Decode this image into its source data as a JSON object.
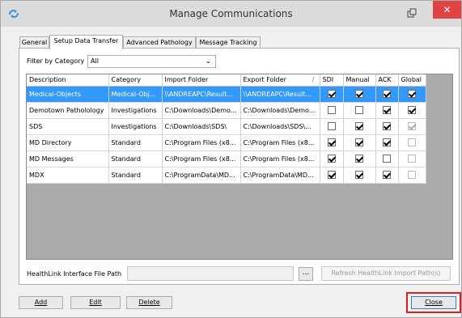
{
  "window": {
    "title": "Manage Communications",
    "close_glyph": "✕"
  },
  "tabs": [
    {
      "label": "General"
    },
    {
      "label": "Setup Data Transfer"
    },
    {
      "label": "Advanced Pathology"
    },
    {
      "label": "Message Tracking"
    }
  ],
  "filter": {
    "label": "Filter by Category",
    "value": "All"
  },
  "table": {
    "columns": [
      "Description",
      "Category",
      "Import Folder",
      "Export Folder",
      "SDI",
      "Manual",
      "ACK",
      "Global"
    ],
    "sort_glyph": "/",
    "rows": [
      {
        "description": "Medical-Objects",
        "category": "Medical-Obj...",
        "import": "\\\\ANDREAPC\\Result...",
        "export": "\\\\ANDREAPC\\Result...",
        "sdi": true,
        "manual": true,
        "ack": true,
        "global": true,
        "global_disabled": false,
        "selected": true
      },
      {
        "description": "Demotown Patholology",
        "category": "Investigations",
        "import": "C:\\Downloads\\Demo...",
        "export": "C:\\Downloads\\Demo...",
        "sdi": false,
        "manual": false,
        "ack": true,
        "global": true,
        "global_disabled": false,
        "selected": false
      },
      {
        "description": "SDS",
        "category": "Investigations",
        "import": "C:\\Downloads\\SDS\\",
        "export": "C:\\Downloads\\SDS\\...",
        "sdi": false,
        "manual": true,
        "ack": true,
        "global": true,
        "global_disabled": true,
        "selected": false
      },
      {
        "description": "MD Directory",
        "category": "Standard",
        "import": "C:\\Program Files (x8...",
        "export": "C:\\Program Files (x8...",
        "sdi": true,
        "manual": true,
        "ack": true,
        "global": false,
        "global_disabled": true,
        "selected": false
      },
      {
        "description": "MD Messages",
        "category": "Standard",
        "import": "C:\\Program Files (x8...",
        "export": "C:\\Program Files (x8...",
        "sdi": true,
        "manual": true,
        "ack": false,
        "global": false,
        "global_disabled": true,
        "selected": false
      },
      {
        "description": "MDX",
        "category": "Standard",
        "import": "C:\\ProgramData\\MD...",
        "export": "C:\\ProgramData\\MD...",
        "sdi": true,
        "manual": true,
        "ack": true,
        "global": false,
        "global_disabled": true,
        "selected": false
      }
    ]
  },
  "healthlink": {
    "label": "HealthLink Interface File Path",
    "value": "",
    "browse_label": "...",
    "refresh_label": "Refresh HealthLink Import Path(s)"
  },
  "buttons": {
    "add": "Add",
    "edit": "Edit",
    "delete": "Delete",
    "close": "Close"
  },
  "colors": {
    "selection": "#3399ff",
    "close_highlight": "#d81f26",
    "title_close": "#e04343"
  }
}
